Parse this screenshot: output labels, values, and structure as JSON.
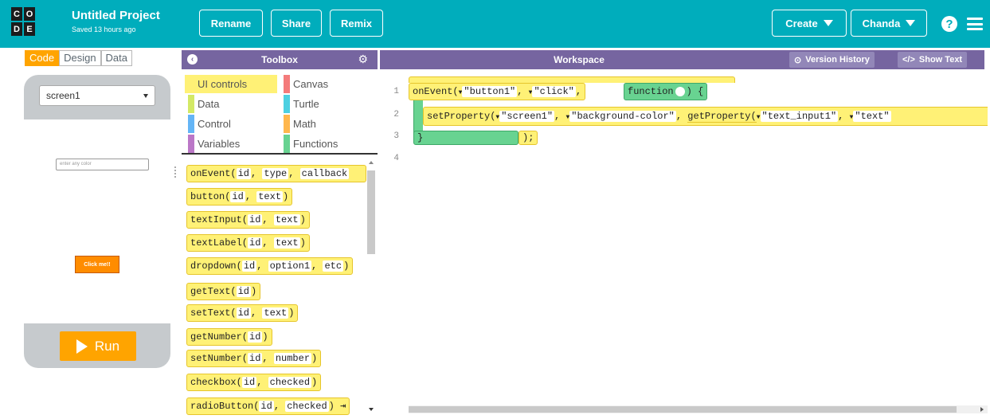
{
  "app": {
    "logo_letters": [
      "C",
      "O",
      "D",
      "E"
    ],
    "project_title": "Untitled Project",
    "saved_text": "Saved 13 hours ago",
    "accent_color": "#00adbc",
    "panel_header_color": "#7665a0"
  },
  "header": {
    "rename_label": "Rename",
    "share_label": "Share",
    "remix_label": "Remix",
    "create_label": "Create",
    "user_label": "Chanda",
    "help_icon": "?",
    "menu_icon": "hamburger-icon"
  },
  "mode_toggle": {
    "code": "Code",
    "design": "Design",
    "data": "Data",
    "active": "Code"
  },
  "app_preview": {
    "screen_selected": "screen1",
    "input_placeholder": "enter any color",
    "button_text": "Click me!!",
    "run_label": "Run"
  },
  "toolbox": {
    "title": "Toolbox",
    "categories": [
      {
        "label": "UI controls",
        "color": "#fff176",
        "selected": true
      },
      {
        "label": "Canvas",
        "color": "#f47b7b"
      },
      {
        "label": "Data",
        "color": "#d3e965"
      },
      {
        "label": "Turtle",
        "color": "#4dd0e1"
      },
      {
        "label": "Control",
        "color": "#64b5f6"
      },
      {
        "label": "Math",
        "color": "#ffb74d"
      },
      {
        "label": "Variables",
        "color": "#bb77c7"
      },
      {
        "label": "Functions",
        "color": "#68d391"
      }
    ],
    "blocks": [
      {
        "name": "onEvent(",
        "args": [
          "id",
          "type",
          "callback"
        ],
        "tail": ""
      },
      {
        "name": "button(",
        "args": [
          "id",
          "text"
        ],
        "tail": ")"
      },
      {
        "name": "textInput(",
        "args": [
          "id",
          "text"
        ],
        "tail": ")"
      },
      {
        "name": "textLabel(",
        "args": [
          "id",
          "text"
        ],
        "tail": ")"
      },
      {
        "name": "dropdown(",
        "args": [
          "id",
          "option1",
          "etc"
        ],
        "tail": ")"
      },
      {
        "name": "getText(",
        "args": [
          "id"
        ],
        "tail": ")"
      },
      {
        "name": "setText(",
        "args": [
          "id",
          "text"
        ],
        "tail": ")"
      },
      {
        "name": "getNumber(",
        "args": [
          "id"
        ],
        "tail": ")"
      },
      {
        "name": "setNumber(",
        "args": [
          "id",
          "number"
        ],
        "tail": ")"
      },
      {
        "name": "checkbox(",
        "args": [
          "id",
          "checked"
        ],
        "tail": ")"
      },
      {
        "name": "radioButton(",
        "args": [
          "id",
          "checked"
        ],
        "tail": ") ⇥"
      }
    ]
  },
  "workspace": {
    "title": "Workspace",
    "version_history_label": "Version History",
    "show_text_label": "Show Text",
    "line_numbers": [
      "1",
      "2",
      "3",
      "4"
    ],
    "code": {
      "line1": {
        "fn": "onEvent(",
        "arg1": "\"button1\"",
        "arg2": "\"click\"",
        "function_keyword": "function",
        "close": ") {"
      },
      "line2": {
        "fn": "setProperty(",
        "arg1": "\"screen1\"",
        "arg2": "\"background-color\"",
        "inner_fn": "getProperty(",
        "inner_arg1": "\"text_input1\"",
        "inner_arg2": "\"text\""
      },
      "line3": {
        "brace": "}",
        "close": ");"
      }
    }
  }
}
